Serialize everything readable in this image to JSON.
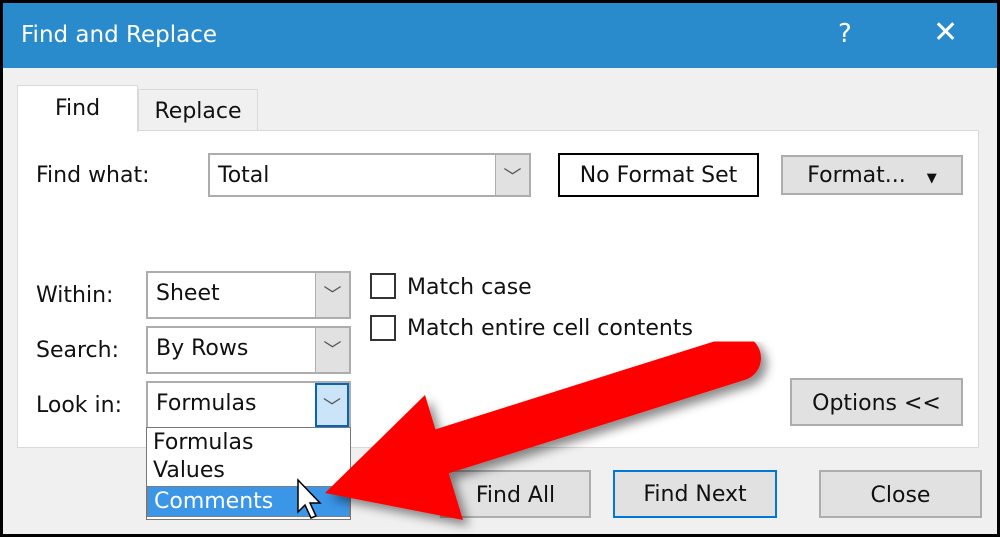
{
  "title": "Find and Replace",
  "help": "?",
  "close_glyph": "✕",
  "tabs": [
    {
      "label": "Find"
    },
    {
      "label": "Replace"
    }
  ],
  "find_what": {
    "label": "Find what:",
    "value": "Total"
  },
  "format_preview": "No Format Set",
  "format_button": "Format...",
  "within": {
    "label": "Within:",
    "value": "Sheet"
  },
  "search": {
    "label": "Search:",
    "value": "By Rows"
  },
  "look_in": {
    "label": "Look in:",
    "value": "Formulas",
    "options": [
      "Formulas",
      "Values",
      "Comments"
    ],
    "highlighted": "Comments"
  },
  "match_case": {
    "label": "Match case",
    "checked": false
  },
  "match_entire": {
    "label": "Match entire cell contents",
    "checked": false
  },
  "options_button": "Options <<",
  "find_all": "Find All",
  "find_next": "Find Next",
  "close_button": "Close",
  "colors": {
    "titlebar": "#2a8bcc",
    "highlight": "#3b96e8",
    "arrow": "#ff0000"
  }
}
